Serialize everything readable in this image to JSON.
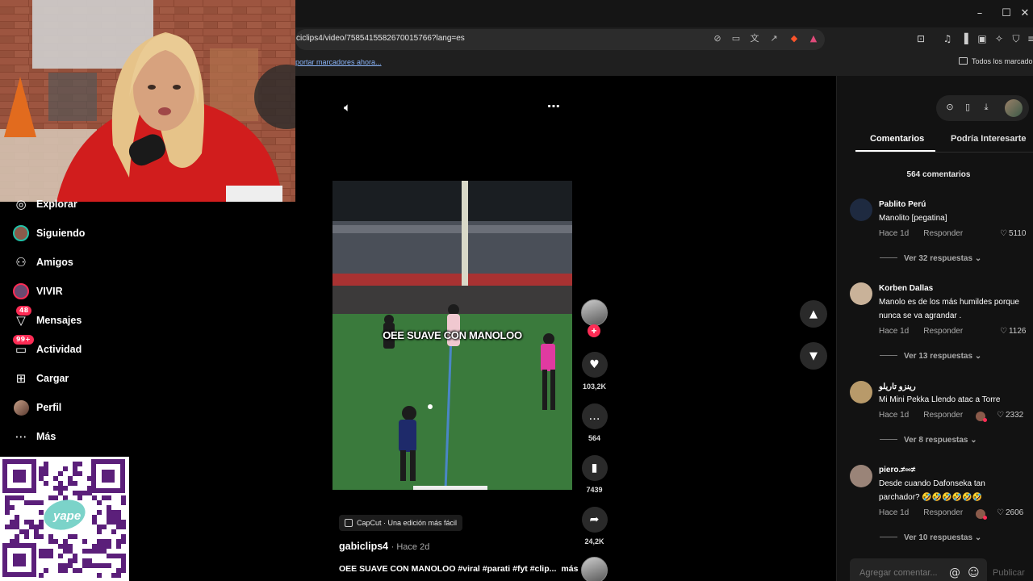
{
  "browser": {
    "url": "ciclips4/video/7585415582670015766?lang=es",
    "bookmarks_import": "portar marcadores ahora...",
    "bookmarks_all": "Todos los marcadores"
  },
  "sidebar": {
    "items": [
      {
        "label": "Explorar",
        "icon": "compass-icon"
      },
      {
        "label": "Siguiendo",
        "icon": "following-avatar-icon"
      },
      {
        "label": "Amigos",
        "icon": "friends-icon"
      },
      {
        "label": "VIVIR",
        "icon": "live-icon"
      },
      {
        "label": "Mensajes",
        "icon": "messages-icon",
        "badge": "48"
      },
      {
        "label": "Actividad",
        "icon": "activity-icon",
        "badge": "99+"
      },
      {
        "label": "Cargar",
        "icon": "upload-icon"
      },
      {
        "label": "Perfil",
        "icon": "profile-avatar-icon"
      },
      {
        "label": "Más",
        "icon": "more-icon"
      }
    ]
  },
  "video": {
    "caption": "OEE SUAVE CON MANOLOO",
    "likes": "103,2K",
    "comments": "564",
    "saves": "7439",
    "shares": "24,2K",
    "capcut": "CapCut · Una edición más fácil",
    "author": "gabiclips4",
    "posted": "· Hace 2d",
    "description": "OEE SUAVE CON MANOLOO #viral #parati #fyt #clip...",
    "more": "más"
  },
  "panel": {
    "tabs": [
      "Comentarios",
      "Podría Interesarte"
    ],
    "comment_count": "564 comentarios",
    "comments": [
      {
        "user": "Pablito Perú",
        "text": "Manolito [pegatina]",
        "time": "Hace 1d",
        "reply": "Responder",
        "likes": "5110",
        "replies": "Ver 32 respuestas",
        "creator_liked": false
      },
      {
        "user": "Korben Dallas",
        "text": "Manolo es de los más humildes porque nunca se va agrandar .",
        "time": "Hace 1d",
        "reply": "Responder",
        "likes": "1126",
        "replies": "Ver 13 respuestas",
        "creator_liked": false
      },
      {
        "user": "رينزو تاريلو",
        "text": "Mi Mini Pekka Llendo atac a Torre",
        "time": "Hace 1d",
        "reply": "Responder",
        "likes": "2332",
        "replies": "Ver 8 respuestas",
        "creator_liked": true
      },
      {
        "user": "piero.≠∞≠",
        "text": "Desde cuando Dafonseka tan parchador? 🤣🤣🤣🤣🤣🤣",
        "time": "Hace 1d",
        "reply": "Responder",
        "likes": "2606",
        "replies": "Ver 10 respuestas",
        "creator_liked": true
      }
    ],
    "input_placeholder": "Agregar comentar...",
    "publish": "Publicar"
  },
  "colors": {
    "accent": "#fe2c55",
    "live_ring": "#22c1a7"
  }
}
